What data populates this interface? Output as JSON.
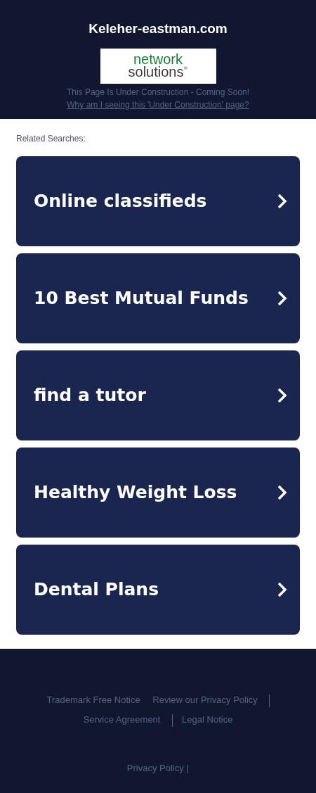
{
  "header": {
    "domain": "Keleher-eastman.com",
    "logo": {
      "line_1": "network",
      "line_2": "solutions",
      "mark": "®"
    },
    "notice": "This Page Is Under Construction - Coming Soon!",
    "notice_link": "Why am I seeing this 'Under Construction' page?"
  },
  "related": {
    "heading": "Related Searches:",
    "items": [
      {
        "label": "Online classifieds"
      },
      {
        "label": "10 Best Mutual Funds"
      },
      {
        "label": "find a tutor"
      },
      {
        "label": "Healthy Weight Loss"
      },
      {
        "label": "Dental Plans"
      }
    ]
  },
  "footer": {
    "links": [
      {
        "label": "Trademark Free Notice",
        "divider_before": false
      },
      {
        "label": "Review our Privacy Policy",
        "divider_before": false
      },
      {
        "label": "Service Agreement",
        "divider_before": true
      },
      {
        "label": "Legal Notice",
        "divider_before": true
      }
    ],
    "bottom_link": "Privacy Policy",
    "bottom_separator": "|"
  }
}
